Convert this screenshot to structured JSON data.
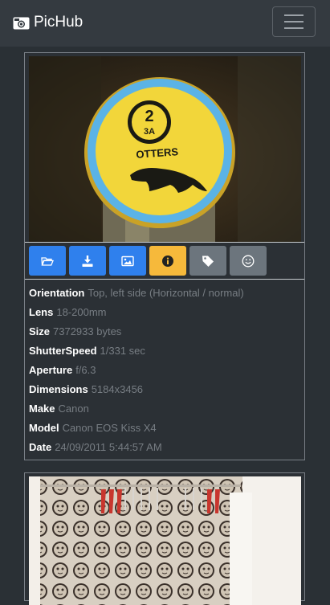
{
  "navbar": {
    "brand": "PicHub",
    "brand_icon": "camera-icon",
    "menu_icon": "hamburger-icon"
  },
  "card1": {
    "photo_desc": "otters-sign-photo",
    "sign": {
      "number": "2",
      "sub": "3A",
      "word": "OTTERS"
    },
    "buttons": [
      {
        "icon": "folder-open-icon",
        "color": "#2f80ed"
      },
      {
        "icon": "download-icon",
        "color": "#2f80ed"
      },
      {
        "icon": "image-icon",
        "color": "#2f80ed"
      },
      {
        "icon": "info-icon",
        "color": "#f6b93b"
      },
      {
        "icon": "tag-icon",
        "color": "#6c757d"
      },
      {
        "icon": "smile-icon",
        "color": "#6c757d"
      }
    ],
    "meta": [
      {
        "key": "Orientation",
        "value": "Top, left side (Horizontal / normal)"
      },
      {
        "key": "Lens",
        "value": "18-200mm"
      },
      {
        "key": "Size",
        "value": "7372933 bytes"
      },
      {
        "key": "ShutterSpeed",
        "value": "1/331 sec"
      },
      {
        "key": "Aperture",
        "value": "f/6.3"
      },
      {
        "key": "Dimensions",
        "value": "5184x3456"
      },
      {
        "key": "Make",
        "value": "Canon"
      },
      {
        "key": "Model",
        "value": "Canon EOS Kiss X4"
      },
      {
        "key": "Date",
        "value": "24/09/2011 5:44:57 AM"
      }
    ]
  }
}
